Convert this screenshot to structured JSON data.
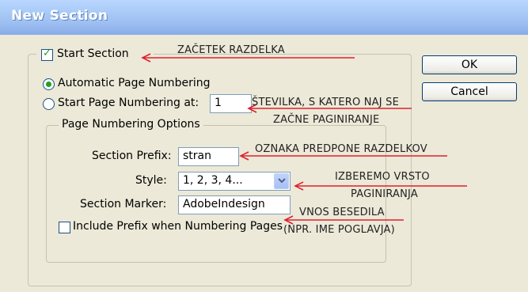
{
  "window": {
    "title": "New Section"
  },
  "section": {
    "start_section_label": "Start Section",
    "start_section_checked": true,
    "auto_numbering_label": "Automatic Page Numbering",
    "auto_numbering_selected": true,
    "start_at_label": "Start Page Numbering at:",
    "start_at_value": "1"
  },
  "page_numbering_options": {
    "legend": "Page Numbering Options",
    "prefix_label": "Section Prefix:",
    "prefix_value": "stran",
    "style_label": "Style:",
    "style_value": "1, 2, 3, 4...",
    "marker_label": "Section Marker:",
    "marker_value": "AdobeIndesign",
    "include_prefix_label": "Include Prefix when Numbering Pages",
    "include_prefix_checked": false
  },
  "buttons": {
    "ok": "OK",
    "cancel": "Cancel"
  },
  "annotations": {
    "start_section": "ZAČETEK RAZDELKA",
    "number_line1": "ŠTEVILKA, S KATERO NAJ SE",
    "number_line2": "ZAČNE PAGINIRANJE",
    "prefix": "OZNAKA PREDPONE RAZDELKOV",
    "style_line1": "IZBEREMO VRSTO",
    "style_line2": "PAGINIRANJA",
    "marker_line1": "VNOS BESEDILA",
    "marker_line2": "(NPR. IME POGLAVJA)"
  },
  "colors": {
    "annotation_arrow": "#e0202e",
    "title_text": "#ffffff"
  }
}
